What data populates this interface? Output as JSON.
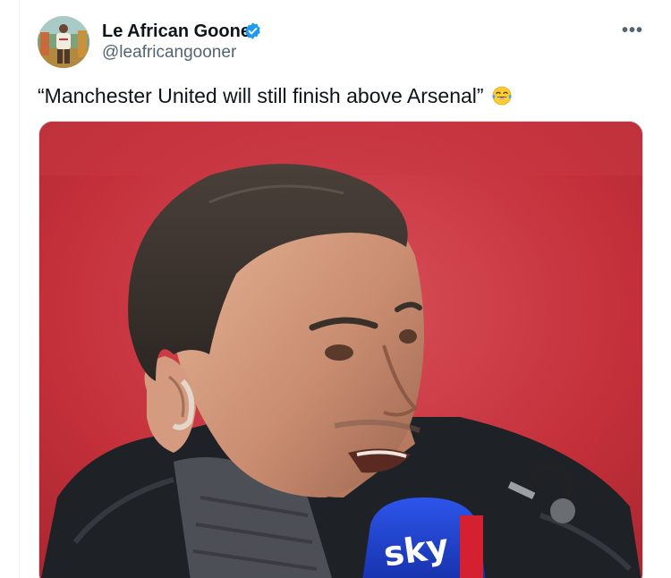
{
  "tweet": {
    "display_name": "Le African Gooner",
    "handle": "@leafricangooner",
    "text": "“Manchester United will still finish above Arsenal”",
    "emoji_icon": "face-with-tears-of-joy-icon",
    "verified_icon": "verified-badge-icon",
    "more_icon": "more-options-icon",
    "more_glyph": "•••"
  },
  "media": {
    "mic_brand": "sky"
  },
  "colors": {
    "text_primary": "#0f1419",
    "text_secondary": "#536471",
    "verified_blue": "#1d9bf0",
    "background_red": "#c4303a",
    "mic_blue": "#1f3fd1"
  }
}
